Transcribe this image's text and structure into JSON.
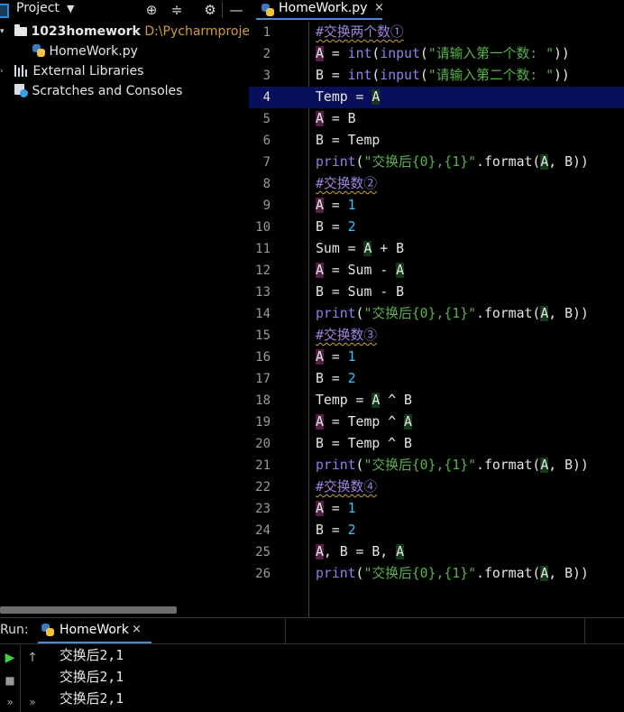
{
  "project_panel": {
    "title": "Project",
    "tree": [
      {
        "label": "1023homework",
        "path": "D:\\Pycharmprojects\\",
        "kind": "folder"
      },
      {
        "label": "HomeWork.py",
        "kind": "python-file"
      },
      {
        "label": "External Libraries",
        "kind": "libraries"
      },
      {
        "label": "Scratches and Consoles",
        "kind": "scratches"
      }
    ]
  },
  "editor": {
    "tab_label": "HomeWork.py",
    "tab_close": "×",
    "current_line": 4,
    "lines": [
      {
        "n": "1",
        "parts": [
          [
            "#交换两个数①",
            "comment"
          ]
        ]
      },
      {
        "n": "2",
        "parts": [
          [
            "A",
            "varA"
          ],
          [
            " = ",
            "plain"
          ],
          [
            "int",
            "builtin"
          ],
          [
            "(",
            "plain"
          ],
          [
            "input",
            "builtin"
          ],
          [
            "(",
            "plain"
          ],
          [
            "\"请输入第一个数: \"",
            "str"
          ],
          [
            "))",
            "plain"
          ]
        ]
      },
      {
        "n": "3",
        "parts": [
          [
            "B = ",
            "plain"
          ],
          [
            "int",
            "builtin"
          ],
          [
            "(",
            "plain"
          ],
          [
            "input",
            "builtin"
          ],
          [
            "(",
            "plain"
          ],
          [
            "\"请输入第二个数: \"",
            "str"
          ],
          [
            "))",
            "plain"
          ]
        ]
      },
      {
        "n": "4",
        "parts": [
          [
            "Temp = ",
            "plain"
          ],
          [
            "A",
            "varA2"
          ]
        ]
      },
      {
        "n": "5",
        "parts": [
          [
            "A",
            "varA"
          ],
          [
            " = B",
            "plain"
          ]
        ]
      },
      {
        "n": "6",
        "parts": [
          [
            "B = Temp",
            "plain"
          ]
        ]
      },
      {
        "n": "7",
        "parts": [
          [
            "print",
            "builtin"
          ],
          [
            "(",
            "plain"
          ],
          [
            "\"交换后{0},{1}\"",
            "str"
          ],
          [
            ".format(",
            "plain"
          ],
          [
            "A",
            "varA2"
          ],
          [
            ", B))",
            "plain"
          ]
        ]
      },
      {
        "n": "8",
        "parts": [
          [
            "#交换数②",
            "comment"
          ]
        ]
      },
      {
        "n": "9",
        "parts": [
          [
            "A",
            "varA"
          ],
          [
            " = ",
            "plain"
          ],
          [
            "1",
            "num"
          ]
        ]
      },
      {
        "n": "10",
        "parts": [
          [
            "B = ",
            "plain"
          ],
          [
            "2",
            "num"
          ]
        ]
      },
      {
        "n": "11",
        "parts": [
          [
            "Sum = ",
            "plain"
          ],
          [
            "A",
            "varA2"
          ],
          [
            " + B",
            "plain"
          ]
        ]
      },
      {
        "n": "12",
        "parts": [
          [
            "A",
            "varA"
          ],
          [
            " = Sum - ",
            "plain"
          ],
          [
            "A",
            "varA2"
          ]
        ]
      },
      {
        "n": "13",
        "parts": [
          [
            "B = Sum - B",
            "plain"
          ]
        ]
      },
      {
        "n": "14",
        "parts": [
          [
            "print",
            "builtin"
          ],
          [
            "(",
            "plain"
          ],
          [
            "\"交换后{0},{1}\"",
            "str"
          ],
          [
            ".format(",
            "plain"
          ],
          [
            "A",
            "varA2"
          ],
          [
            ", B))",
            "plain"
          ]
        ]
      },
      {
        "n": "15",
        "parts": [
          [
            "#交换数③",
            "comment"
          ]
        ]
      },
      {
        "n": "16",
        "parts": [
          [
            "A",
            "varA"
          ],
          [
            " = ",
            "plain"
          ],
          [
            "1",
            "num"
          ]
        ]
      },
      {
        "n": "17",
        "parts": [
          [
            "B = ",
            "plain"
          ],
          [
            "2",
            "num"
          ]
        ]
      },
      {
        "n": "18",
        "parts": [
          [
            "Temp = ",
            "plain"
          ],
          [
            "A",
            "varA2"
          ],
          [
            " ^ B",
            "plain"
          ]
        ]
      },
      {
        "n": "19",
        "parts": [
          [
            "A",
            "varA"
          ],
          [
            " = Temp ^ ",
            "plain"
          ],
          [
            "A",
            "varA2"
          ]
        ]
      },
      {
        "n": "20",
        "parts": [
          [
            "B = Temp ^ B",
            "plain"
          ]
        ]
      },
      {
        "n": "21",
        "parts": [
          [
            "print",
            "builtin"
          ],
          [
            "(",
            "plain"
          ],
          [
            "\"交换后{0},{1}\"",
            "str"
          ],
          [
            ".format(",
            "plain"
          ],
          [
            "A",
            "varA2"
          ],
          [
            ", B))",
            "plain"
          ]
        ]
      },
      {
        "n": "22",
        "parts": [
          [
            "#交换数④",
            "comment"
          ]
        ]
      },
      {
        "n": "23",
        "parts": [
          [
            "A",
            "varA"
          ],
          [
            " = ",
            "plain"
          ],
          [
            "1",
            "num"
          ]
        ]
      },
      {
        "n": "24",
        "parts": [
          [
            "B = ",
            "plain"
          ],
          [
            "2",
            "num"
          ]
        ]
      },
      {
        "n": "25",
        "parts": [
          [
            "A",
            "varA"
          ],
          [
            ", B = B, ",
            "plain"
          ],
          [
            "A",
            "varA2"
          ]
        ]
      },
      {
        "n": "26",
        "parts": [
          [
            "print",
            "builtin"
          ],
          [
            "(",
            "plain"
          ],
          [
            "\"交换后{0},{1}\"",
            "str"
          ],
          [
            ".format(",
            "plain"
          ],
          [
            "A",
            "varA2"
          ],
          [
            ", B))",
            "plain"
          ]
        ]
      }
    ]
  },
  "run_panel": {
    "label": "Run:",
    "tab_label": "HomeWork",
    "tab_close": "×",
    "output": [
      "交换后2,1",
      "交换后2,1",
      "交换后2,1"
    ]
  },
  "colors": {
    "background": "#000000",
    "current_line": "#08105e",
    "tab_underline": "#4a8bd4",
    "builtin": "#8f82e8",
    "string": "#59b04c",
    "number": "#3fc0f0",
    "run_button": "#3fd13f"
  },
  "icons": [
    "project-icon",
    "locate-icon",
    "collapse-icon",
    "settings-gear-icon",
    "minimize-icon",
    "folder-icon",
    "python-file-icon",
    "libraries-icon",
    "scratches-icon",
    "run-icon",
    "stop-icon",
    "scroll-up-icon",
    "more-icon"
  ]
}
